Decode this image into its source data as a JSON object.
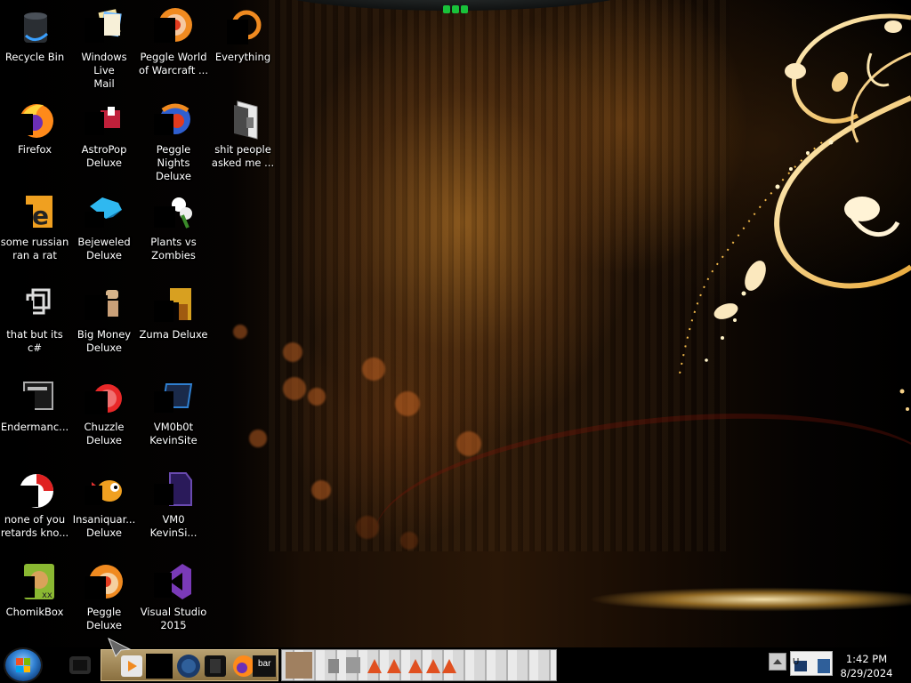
{
  "desktop": {
    "icons": [
      {
        "label": "Recycle Bin",
        "icon": "recycle-bin-icon"
      },
      {
        "label": "Windows Live\nMail",
        "icon": "windows-live-mail-icon"
      },
      {
        "label": "Peggle World\nof Warcraft ...",
        "icon": "peggle-wow-icon"
      },
      {
        "label": "Everything",
        "icon": "everything-search-icon"
      },
      {
        "label": "Firefox",
        "icon": "firefox-icon"
      },
      {
        "label": "AstroPop\nDeluxe",
        "icon": "astropop-icon"
      },
      {
        "label": "Peggle Nights\nDeluxe",
        "icon": "peggle-nights-icon"
      },
      {
        "label": "shit people\nasked me ...",
        "icon": "file-icon"
      },
      {
        "label": "some russian\nran a rat",
        "icon": "e-app-icon"
      },
      {
        "label": "Bejeweled\nDeluxe",
        "icon": "bejeweled-icon"
      },
      {
        "label": "Plants vs\nZombies",
        "icon": "plants-vs-zombies-icon"
      },
      {
        "label": "that but its c#",
        "icon": "copy-files-icon"
      },
      {
        "label": "Big Money\nDeluxe",
        "icon": "big-money-icon"
      },
      {
        "label": "Zuma Deluxe",
        "icon": "zuma-icon"
      },
      {
        "label": "Endermanc...",
        "icon": "terminal-icon"
      },
      {
        "label": "Chuzzle\nDeluxe",
        "icon": "chuzzle-icon"
      },
      {
        "label": "VM0b0t\nKevinSite",
        "icon": "vm-folder-icon"
      },
      {
        "label": "none of you\nretards kno...",
        "icon": "red-app-icon"
      },
      {
        "label": "Insaniquar...\nDeluxe",
        "icon": "insaniquarium-icon"
      },
      {
        "label": "VM0\nKevinSi...",
        "icon": "vm-file-icon"
      },
      {
        "label": "ChomikBox",
        "icon": "chomikbox-icon"
      },
      {
        "label": "Peggle Deluxe",
        "icon": "peggle-deluxe-icon"
      },
      {
        "label": "Visual Studio\n2015",
        "icon": "visual-studio-icon"
      }
    ]
  },
  "taskbar": {
    "start_button": "start-orb-icon",
    "tray_label": "U",
    "clock_time": "1:42 PM",
    "clock_date": "8/29/2024",
    "pinned_label": "bar"
  },
  "colors": {
    "accent_gold": "#f2c35a",
    "taskbar_bg": "#000000",
    "label_text": "#ffffff"
  }
}
